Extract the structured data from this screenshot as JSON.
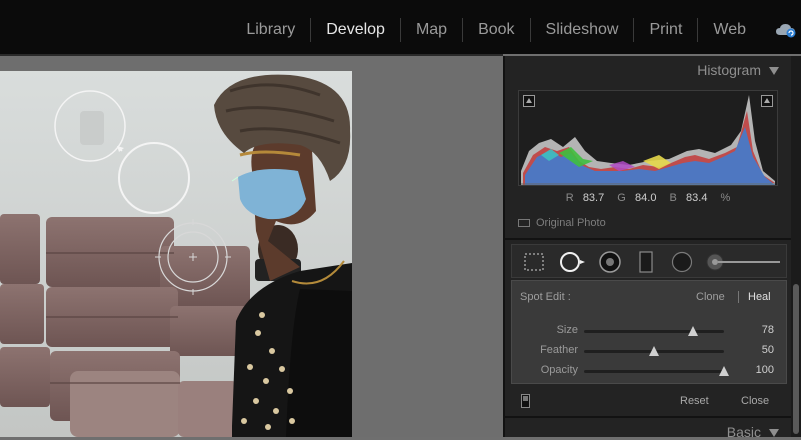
{
  "modules": [
    "Library",
    "Develop",
    "Map",
    "Book",
    "Slideshow",
    "Print",
    "Web"
  ],
  "active_module": "Develop",
  "histogram": {
    "title": "Histogram",
    "r_label": "R",
    "r_value": "83.7",
    "g_label": "G",
    "g_value": "84.0",
    "b_label": "B",
    "b_value": "83.4",
    "unit": "%",
    "original_photo_label": "Original Photo"
  },
  "spot_edit": {
    "label": "Spot Edit :",
    "modes": [
      "Clone",
      "Heal"
    ],
    "active_mode": "Heal",
    "sliders": [
      {
        "label": "Size",
        "value": "78",
        "fraction": 0.78
      },
      {
        "label": "Feather",
        "value": "50",
        "fraction": 0.5
      },
      {
        "label": "Opacity",
        "value": "100",
        "fraction": 1.0
      }
    ],
    "reset_label": "Reset",
    "close_label": "Close"
  },
  "basic": {
    "title": "Basic"
  },
  "icons": [
    "cloud-sync-icon",
    "crop-tool-icon",
    "spot-removal-tool-icon",
    "red-eye-tool-icon",
    "graduated-filter-icon",
    "radial-filter-icon",
    "adjustment-brush-icon"
  ]
}
